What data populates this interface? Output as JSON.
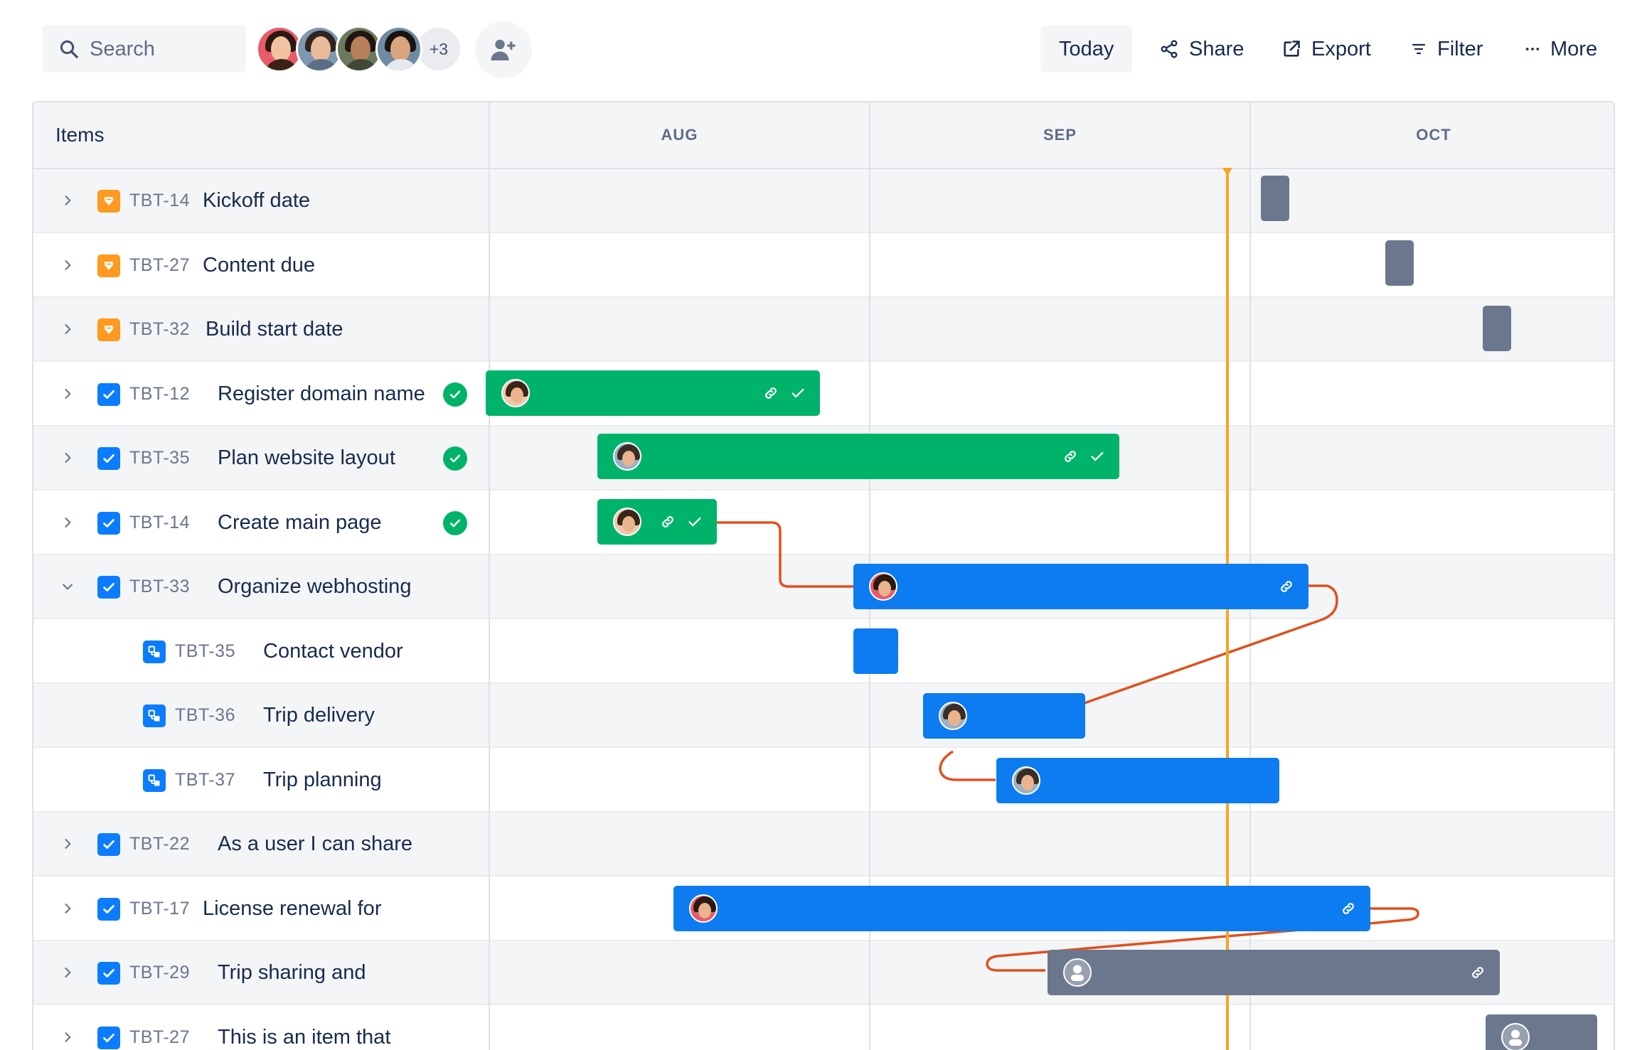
{
  "toolbar": {
    "search_placeholder": "Search",
    "extra_count": "+3",
    "today_label": "Today",
    "share_label": "Share",
    "export_label": "Export",
    "filter_label": "Filter",
    "more_label": "More"
  },
  "grid": {
    "items_header": "Items",
    "months": [
      "AUG",
      "SEP",
      "OCT"
    ]
  },
  "rows": [
    {
      "key": "TBT-14",
      "title": "Kickoff date",
      "type": "milestone",
      "done": false
    },
    {
      "key": "TBT-27",
      "title": "Content due",
      "type": "milestone",
      "done": false
    },
    {
      "key": "TBT-32",
      "title": "Build start date",
      "type": "milestone",
      "done": false
    },
    {
      "key": "TBT-12",
      "title": "Register domain name",
      "type": "task",
      "done": true
    },
    {
      "key": "TBT-35",
      "title": "Plan website layout",
      "type": "task",
      "done": true
    },
    {
      "key": "TBT-14",
      "title": "Create main page",
      "type": "task",
      "done": true
    },
    {
      "key": "TBT-33",
      "title": "Organize webhosting",
      "type": "task",
      "done": false
    },
    {
      "key": "TBT-35",
      "title": "Contact vendor",
      "type": "subtask",
      "done": false
    },
    {
      "key": "TBT-36",
      "title": "Trip delivery",
      "type": "subtask",
      "done": false
    },
    {
      "key": "TBT-37",
      "title": "Trip planning",
      "type": "subtask",
      "done": false
    },
    {
      "key": "TBT-22",
      "title": "As a user I can share",
      "type": "task",
      "done": false
    },
    {
      "key": "TBT-17",
      "title": "License renewal for",
      "type": "task",
      "done": false
    },
    {
      "key": "TBT-29",
      "title": "Trip sharing and",
      "type": "task",
      "done": false
    },
    {
      "key": "TBT-27",
      "title": "This is an item that",
      "type": "task",
      "done": false
    }
  ],
  "colors": {
    "done_bar": "#00b36b",
    "active_bar": "#0c7cf0",
    "unassigned_bar": "#6b778c",
    "today_line": "#f5a623",
    "dependency": "#e0501e",
    "milestone_icon": "#ff991f",
    "task_icon": "#0c7cff"
  }
}
